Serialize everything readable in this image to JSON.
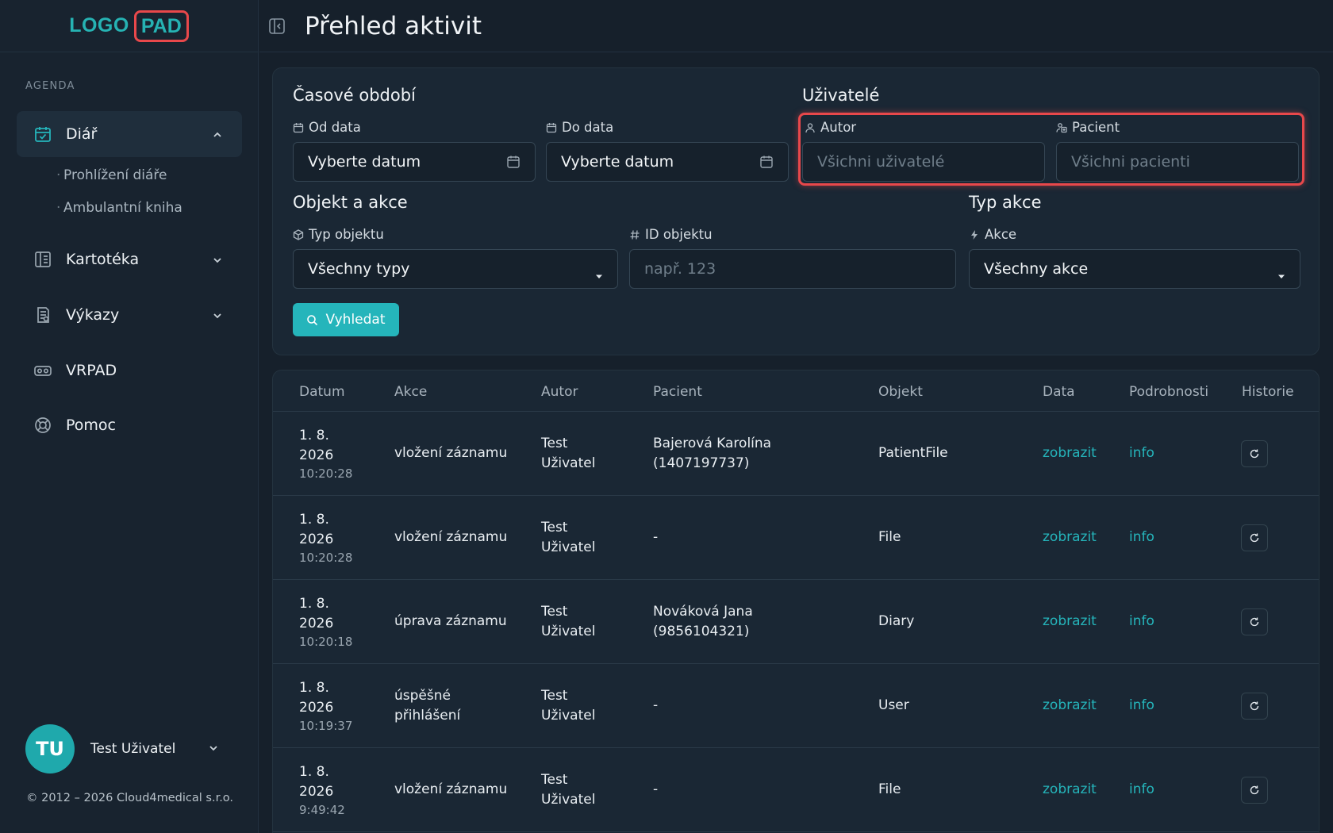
{
  "logo": {
    "left": "LOGO",
    "right": "PAD"
  },
  "sidebar": {
    "section": "AGENDA",
    "items": [
      {
        "label": "Diář",
        "icon": "calendar-check-icon",
        "expanded": true,
        "children": [
          "Prohlížení diáře",
          "Ambulantní kniha"
        ]
      },
      {
        "label": "Kartotéka",
        "icon": "folder-icon"
      },
      {
        "label": "Výkazy",
        "icon": "report-icon"
      },
      {
        "label": "VRPAD",
        "icon": "vr-headset-icon"
      },
      {
        "label": "Pomoc",
        "icon": "lifebuoy-icon"
      }
    ],
    "user": {
      "initials": "TU",
      "name": "Test Uživatel"
    },
    "copyright": "© 2012 – 2026 Cloud4medical s.r.o."
  },
  "header": {
    "title": "Přehled aktivit"
  },
  "filters": {
    "period_title": "Časové období",
    "from_label": "Od data",
    "from_value": "Vyberte datum",
    "to_label": "Do data",
    "to_value": "Vyberte datum",
    "users_title": "Uživatelé",
    "author_label": "Autor",
    "author_placeholder": "Všichni uživatelé",
    "patient_label": "Pacient",
    "patient_placeholder": "Všichni pacienti",
    "object_title": "Objekt a akce",
    "object_type_label": "Typ objektu",
    "object_type_value": "Všechny typy",
    "object_id_label": "ID objektu",
    "object_id_placeholder": "např. 123",
    "action_type_title": "Typ akce",
    "action_label": "Akce",
    "action_value": "Všechny akce",
    "search_button": "Vyhledat"
  },
  "table": {
    "headers": [
      "Datum",
      "Akce",
      "Autor",
      "Pacient",
      "Objekt",
      "Data",
      "Podrobnosti",
      "Historie"
    ],
    "rows": [
      {
        "date1": "1. 8.",
        "date2": "2026",
        "time": "10:20:28",
        "action1": "vložení záznamu",
        "action2": "",
        "author1": "Test",
        "author2": "Uživatel",
        "patient1": "Bajerová Karolína",
        "patient2": "(1407197737)",
        "object": "PatientFile",
        "data": "zobrazit",
        "details": "info"
      },
      {
        "date1": "1. 8.",
        "date2": "2026",
        "time": "10:20:28",
        "action1": "vložení záznamu",
        "action2": "",
        "author1": "Test",
        "author2": "Uživatel",
        "patient1": "-",
        "patient2": "",
        "object": "File",
        "data": "zobrazit",
        "details": "info"
      },
      {
        "date1": "1. 8.",
        "date2": "2026",
        "time": "10:20:18",
        "action1": "úprava záznamu",
        "action2": "",
        "author1": "Test",
        "author2": "Uživatel",
        "patient1": "Nováková Jana",
        "patient2": "(9856104321)",
        "object": "Diary",
        "data": "zobrazit",
        "details": "info"
      },
      {
        "date1": "1. 8.",
        "date2": "2026",
        "time": "10:19:37",
        "action1": "úspěšné",
        "action2": "přihlášení",
        "author1": "Test",
        "author2": "Uživatel",
        "patient1": "-",
        "patient2": "",
        "object": "User",
        "data": "zobrazit",
        "details": "info"
      },
      {
        "date1": "1. 8.",
        "date2": "2026",
        "time": "9:49:42",
        "action1": "vložení záznamu",
        "action2": "",
        "author1": "Test",
        "author2": "Uživatel",
        "patient1": "-",
        "patient2": "",
        "object": "File",
        "data": "zobrazit",
        "details": "info"
      }
    ]
  },
  "colors": {
    "accent": "#25b5bb",
    "highlight": "#e8484b",
    "background": "#16202b"
  }
}
